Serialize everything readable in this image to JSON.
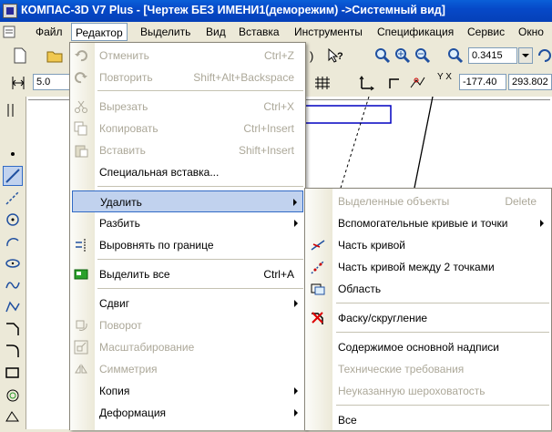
{
  "window": {
    "title": "КОМПАС-3D V7 Plus - [Чертеж БЕЗ ИМЕНИ1(деморежим) ->Системный вид]"
  },
  "menubar": {
    "items": [
      "Файл",
      "Редактор",
      "Выделить",
      "Вид",
      "Вставка",
      "Инструменты",
      "Спецификация",
      "Сервис",
      "Окно"
    ]
  },
  "toolbar": {
    "zoom_value": "0.3415",
    "step_value": "5.0",
    "coord_x": "-177.40",
    "coord_y": "293.802",
    "coord_label": "Y X"
  },
  "editor_menu": {
    "items": [
      {
        "label": "Отменить",
        "shortcut": "Ctrl+Z",
        "disabled": true,
        "icon": "undo-icon"
      },
      {
        "label": "Повторить",
        "shortcut": "Shift+Alt+Backspace",
        "disabled": true,
        "icon": "redo-icon"
      },
      {
        "label": "Вырезать",
        "shortcut": "Ctrl+X",
        "disabled": true,
        "icon": "cut-icon"
      },
      {
        "label": "Копировать",
        "shortcut": "Ctrl+Insert",
        "disabled": true,
        "icon": "copy-icon"
      },
      {
        "label": "Вставить",
        "shortcut": "Shift+Insert",
        "disabled": true,
        "icon": "paste-icon"
      },
      {
        "label": "Специальная вставка...",
        "shortcut": "",
        "disabled": false,
        "icon": ""
      },
      {
        "label": "Удалить",
        "shortcut": "",
        "disabled": false,
        "icon": "",
        "submenu": true,
        "highlighted": true
      },
      {
        "label": "Разбить",
        "shortcut": "",
        "disabled": false,
        "icon": "",
        "submenu": true
      },
      {
        "label": "Выровнять по границе",
        "shortcut": "",
        "disabled": false,
        "icon": "align-boundary-icon"
      },
      {
        "label": "Выделить все",
        "shortcut": "Ctrl+A",
        "disabled": false,
        "icon": "select-all-icon"
      },
      {
        "label": "Сдвиг",
        "shortcut": "",
        "disabled": false,
        "icon": "",
        "submenu": true
      },
      {
        "label": "Поворот",
        "shortcut": "",
        "disabled": true,
        "icon": "rotate-icon"
      },
      {
        "label": "Масштабирование",
        "shortcut": "",
        "disabled": true,
        "icon": "scale-icon"
      },
      {
        "label": "Симметрия",
        "shortcut": "",
        "disabled": true,
        "icon": "symmetry-icon"
      },
      {
        "label": "Копия",
        "shortcut": "",
        "disabled": false,
        "icon": "",
        "submenu": true
      },
      {
        "label": "Деформация",
        "shortcut": "",
        "disabled": false,
        "icon": "",
        "submenu": true
      }
    ]
  },
  "delete_submenu": {
    "items": [
      {
        "label": "Выделенные объекты",
        "shortcut": "Delete",
        "disabled": true,
        "icon": ""
      },
      {
        "label": "Вспомогательные кривые и точки",
        "shortcut": "",
        "disabled": false,
        "icon": "",
        "submenu": true
      },
      {
        "label": "Часть кривой",
        "shortcut": "",
        "disabled": false,
        "icon": "curve-part-icon"
      },
      {
        "label": "Часть кривой между 2 точками",
        "shortcut": "",
        "disabled": false,
        "icon": "curve-between-points-icon"
      },
      {
        "label": "Область",
        "shortcut": "",
        "disabled": false,
        "icon": "area-icon"
      },
      {
        "label": "Фаску/скругление",
        "shortcut": "",
        "disabled": false,
        "icon": "chamfer-icon"
      },
      {
        "label": "Содержимое основной надписи",
        "shortcut": "",
        "disabled": false,
        "icon": ""
      },
      {
        "label": "Технические требования",
        "shortcut": "",
        "disabled": true,
        "icon": ""
      },
      {
        "label": "Неуказанную шероховатость",
        "shortcut": "",
        "disabled": true,
        "icon": ""
      },
      {
        "label": "Все",
        "shortcut": "",
        "disabled": false,
        "icon": ""
      }
    ]
  },
  "colors": {
    "titlebar": "#0649c8",
    "highlight": "#c1d2ee",
    "highlight_border": "#316ac5",
    "disabled_text": "#aca899"
  }
}
